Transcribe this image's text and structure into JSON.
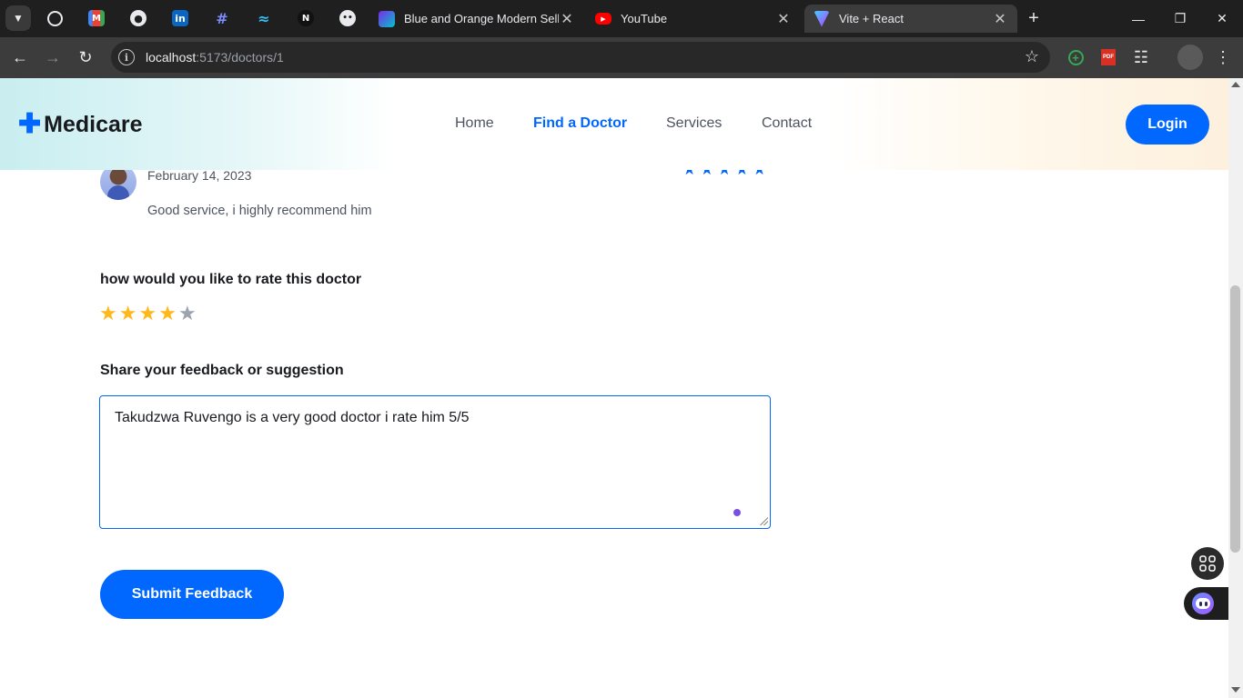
{
  "browser": {
    "pinned_tabs": [
      {
        "icon": "whatsapp-icon",
        "color": "#25d366"
      },
      {
        "icon": "gmail-icon",
        "color": "#ea4335"
      },
      {
        "icon": "github-icon",
        "color": "#ffffff"
      },
      {
        "icon": "linkedin-icon",
        "color": "#0a66c2"
      },
      {
        "icon": "hashtag-icon",
        "color": "#5865f2"
      },
      {
        "icon": "tailwind-icon",
        "color": "#38bdf8"
      },
      {
        "icon": "notion-icon",
        "color": "#000000"
      },
      {
        "icon": "chat-icon",
        "color": "#ffffff"
      }
    ],
    "tabs": [
      {
        "title": "Blue and Orange Modern Selling",
        "icon": "canva-icon",
        "active": false
      },
      {
        "title": "YouTube",
        "icon": "youtube-icon",
        "active": false
      },
      {
        "title": "Vite + React",
        "icon": "vite-icon",
        "active": true
      }
    ],
    "url_host": "localhost",
    "url_path": ":5173/doctors/1"
  },
  "site": {
    "logo_text": "Medicare",
    "nav": [
      "Home",
      "Find a Doctor",
      "Services",
      "Contact"
    ],
    "active_nav": "Find a Doctor",
    "login_label": "Login",
    "accent_color": "#0067ff"
  },
  "review": {
    "date": "February 14, 2023",
    "text": "Good service, i highly recommend him",
    "rating": 5,
    "max_rating": 5
  },
  "rating_form": {
    "heading": "how would you like to rate this doctor",
    "selected_rating": 4,
    "max_rating": 5,
    "filled_color": "#ffb81c",
    "empty_color": "#9ca3af"
  },
  "feedback_form": {
    "heading": "Share your feedback or suggestion",
    "value": "Takudzwa Ruvengo is a very good doctor i rate him 5/5",
    "submit_label": "Submit Feedback"
  }
}
